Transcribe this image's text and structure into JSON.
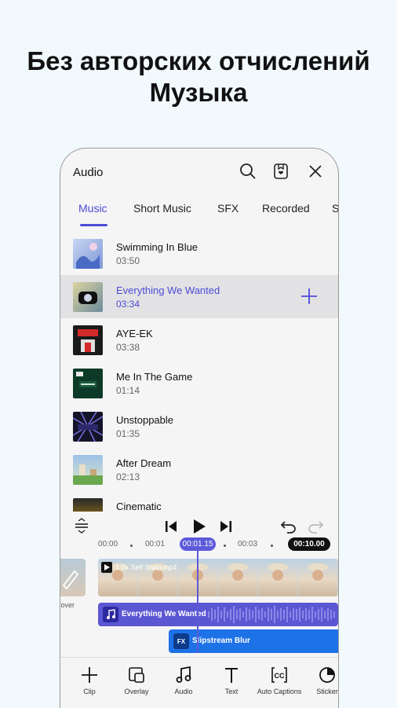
{
  "headline": {
    "line1": "Без авторских отчислений",
    "line2": "Музыка"
  },
  "app": {
    "title": "Audio",
    "icons": [
      "search-icon",
      "saved-icon",
      "close-icon"
    ],
    "tabs": [
      {
        "label": "Music",
        "active": true
      },
      {
        "label": "Short Music",
        "active": false
      },
      {
        "label": "SFX",
        "active": false
      },
      {
        "label": "Recorded",
        "active": false
      },
      {
        "label": "S",
        "active": false
      }
    ],
    "tracks": [
      {
        "title": "Swimming In Blue",
        "duration": "03:50"
      },
      {
        "title": "Everything We Wanted",
        "duration": "03:34",
        "selected": true
      },
      {
        "title": "AYE-EK",
        "duration": "03:38"
      },
      {
        "title": "Me In The Game",
        "duration": "01:14"
      },
      {
        "title": "Unstoppable",
        "duration": "01:35"
      },
      {
        "title": "After Dream",
        "duration": "02:13"
      },
      {
        "title": "Cinematic",
        "duration": ""
      }
    ]
  },
  "editor": {
    "ruler": [
      "00:00",
      "00:01",
      "00:03"
    ],
    "current_time": "00:01.15",
    "total_time": "00:10.00",
    "cover_label": "Cover",
    "video_clip": "1.0x Self Snap.mp4",
    "audio_clip": "Everything We Wanted",
    "effect_clip": "Slipstream Blur",
    "effect_badge": "FX"
  },
  "toolbar": [
    {
      "label": "Clip"
    },
    {
      "label": "Overlay"
    },
    {
      "label": "Audio"
    },
    {
      "label": "Text"
    },
    {
      "label": "Auto Captions"
    },
    {
      "label": "Sticker"
    }
  ],
  "colors": {
    "accent": "#4e4bd6",
    "effect": "#1e72e8",
    "background": "#f1f9fc"
  }
}
